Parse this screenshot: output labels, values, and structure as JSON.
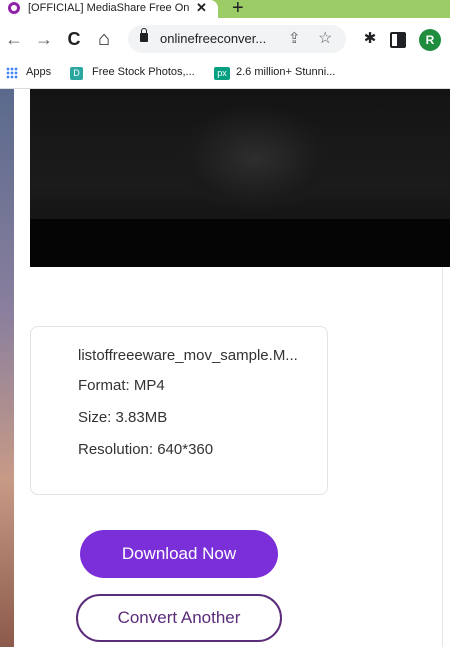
{
  "browser": {
    "tab": {
      "title": "[OFFICIAL] MediaShare Free Online",
      "close_glyph": "✕"
    },
    "newtab_glyph": "+",
    "toolbar": {
      "back_glyph": "←",
      "forward_glyph": "→",
      "reload_glyph": "C",
      "home_glyph": "⌂",
      "url": "onlinefreeconver...",
      "share_glyph": "⇪",
      "star_glyph": "☆",
      "extensions_glyph": "✱",
      "profile_initial": "R"
    },
    "bookmarks": [
      {
        "label": "Apps"
      },
      {
        "label": "Free Stock Photos,...",
        "icon_text": "D"
      },
      {
        "label": "2.6 million+ Stunni...",
        "icon_text": "px"
      }
    ]
  },
  "file_info": {
    "filename": "listoffreeeware_mov_sample.M...",
    "format": "Format: MP4",
    "size": "Size: 3.83MB",
    "resolution": "Resolution: 640*360"
  },
  "actions": {
    "download_label": "Download Now",
    "convert_label": "Convert Another"
  },
  "colors": {
    "tabstrip": "#9ccc65",
    "download_button": "#7b2fd9",
    "convert_border": "#5b2c7a",
    "profile": "#1e8e3e"
  }
}
